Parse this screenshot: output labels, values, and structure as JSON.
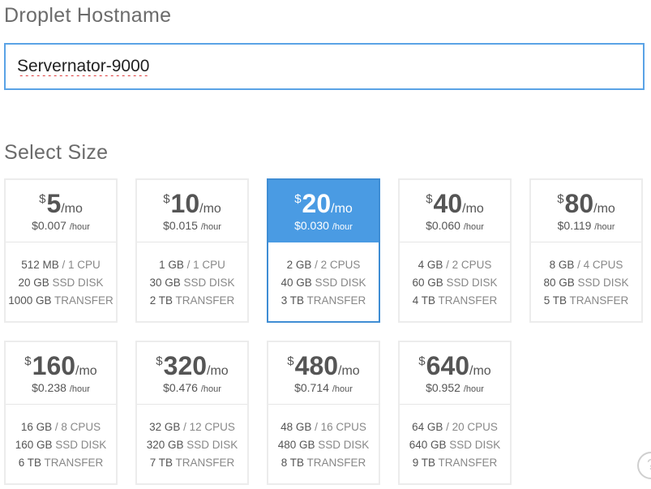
{
  "hostname": {
    "title": "Droplet Hostname",
    "value": "Servernator-9000"
  },
  "size": {
    "title": "Select Size",
    "selected_index": 2,
    "currency": "$",
    "per_month": "/mo",
    "per_hour": "/hour",
    "plans": [
      {
        "price": "5",
        "hourly": "$0.007",
        "ram": "512 MB",
        "cpu": "/ 1 CPU",
        "disk": "20 GB",
        "disk_label": "SSD DISK",
        "transfer": "1000 GB",
        "transfer_label": "TRANSFER"
      },
      {
        "price": "10",
        "hourly": "$0.015",
        "ram": "1 GB",
        "cpu": "/ 1 CPU",
        "disk": "30 GB",
        "disk_label": "SSD DISK",
        "transfer": "2 TB",
        "transfer_label": "TRANSFER"
      },
      {
        "price": "20",
        "hourly": "$0.030",
        "ram": "2 GB",
        "cpu": "/ 2 CPUS",
        "disk": "40 GB",
        "disk_label": "SSD DISK",
        "transfer": "3 TB",
        "transfer_label": "TRANSFER"
      },
      {
        "price": "40",
        "hourly": "$0.060",
        "ram": "4 GB",
        "cpu": "/ 2 CPUS",
        "disk": "60 GB",
        "disk_label": "SSD DISK",
        "transfer": "4 TB",
        "transfer_label": "TRANSFER"
      },
      {
        "price": "80",
        "hourly": "$0.119",
        "ram": "8 GB",
        "cpu": "/ 4 CPUS",
        "disk": "80 GB",
        "disk_label": "SSD DISK",
        "transfer": "5 TB",
        "transfer_label": "TRANSFER"
      },
      {
        "price": "160",
        "hourly": "$0.238",
        "ram": "16 GB",
        "cpu": "/ 8 CPUS",
        "disk": "160 GB",
        "disk_label": "SSD DISK",
        "transfer": "6 TB",
        "transfer_label": "TRANSFER"
      },
      {
        "price": "320",
        "hourly": "$0.476",
        "ram": "32 GB",
        "cpu": "/ 12 CPUS",
        "disk": "320 GB",
        "disk_label": "SSD DISK",
        "transfer": "7 TB",
        "transfer_label": "TRANSFER"
      },
      {
        "price": "480",
        "hourly": "$0.714",
        "ram": "48 GB",
        "cpu": "/ 16 CPUS",
        "disk": "480 GB",
        "disk_label": "SSD DISK",
        "transfer": "8 TB",
        "transfer_label": "TRANSFER"
      },
      {
        "price": "640",
        "hourly": "$0.952",
        "ram": "64 GB",
        "cpu": "/ 20 CPUS",
        "disk": "640 GB",
        "disk_label": "SSD DISK",
        "transfer": "9 TB",
        "transfer_label": "TRANSFER"
      }
    ]
  },
  "help": {
    "icon": "help-icon",
    "glyph": "?"
  },
  "colors": {
    "accent": "#4a9be3",
    "input_border": "#5aa3e6",
    "card_border": "#ececec"
  }
}
